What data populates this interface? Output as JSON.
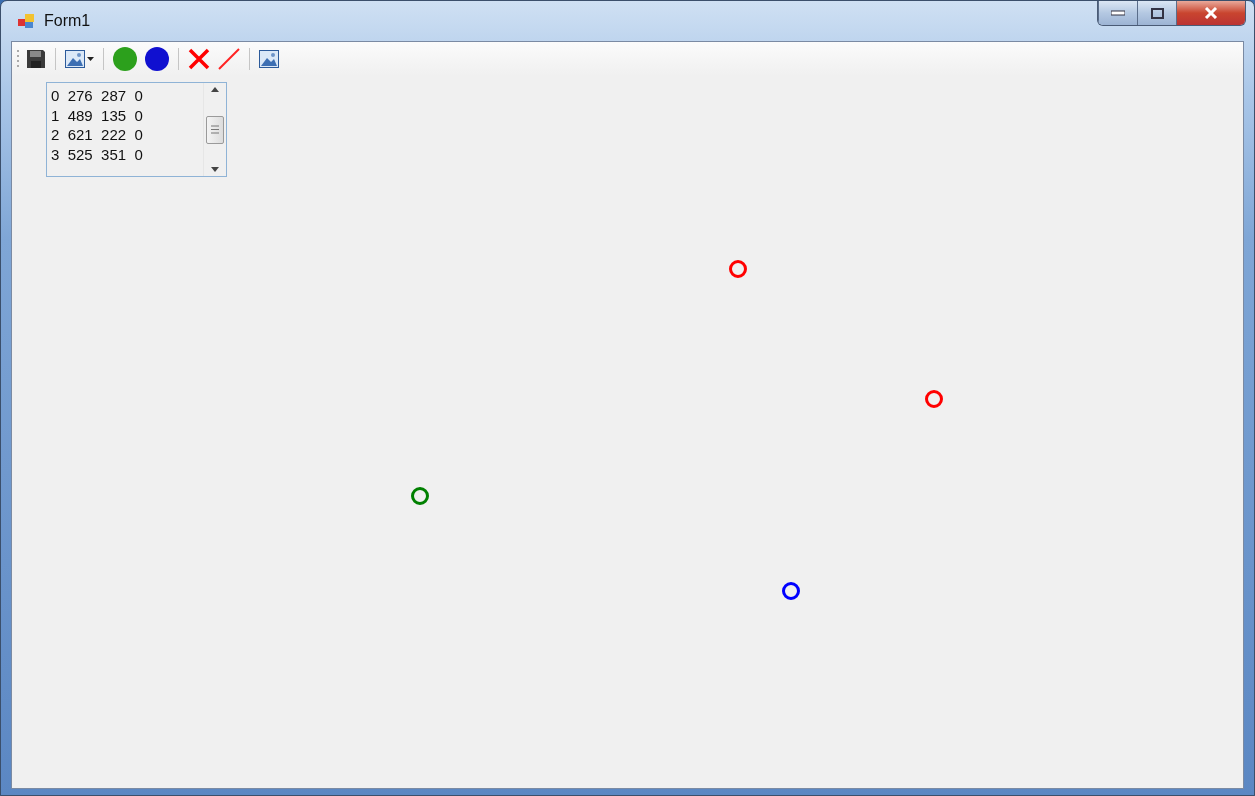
{
  "window": {
    "title": "Form1"
  },
  "listbox": {
    "lines": [
      "0  276  287  0",
      "1  489  135  0",
      "2  621  222  0",
      "3  525  351  0"
    ]
  },
  "canvas": {
    "points": [
      {
        "color": "#008000"
      },
      {
        "color": "#ff0000"
      },
      {
        "color": "#ff0000"
      },
      {
        "color": "#0000ff"
      }
    ]
  }
}
